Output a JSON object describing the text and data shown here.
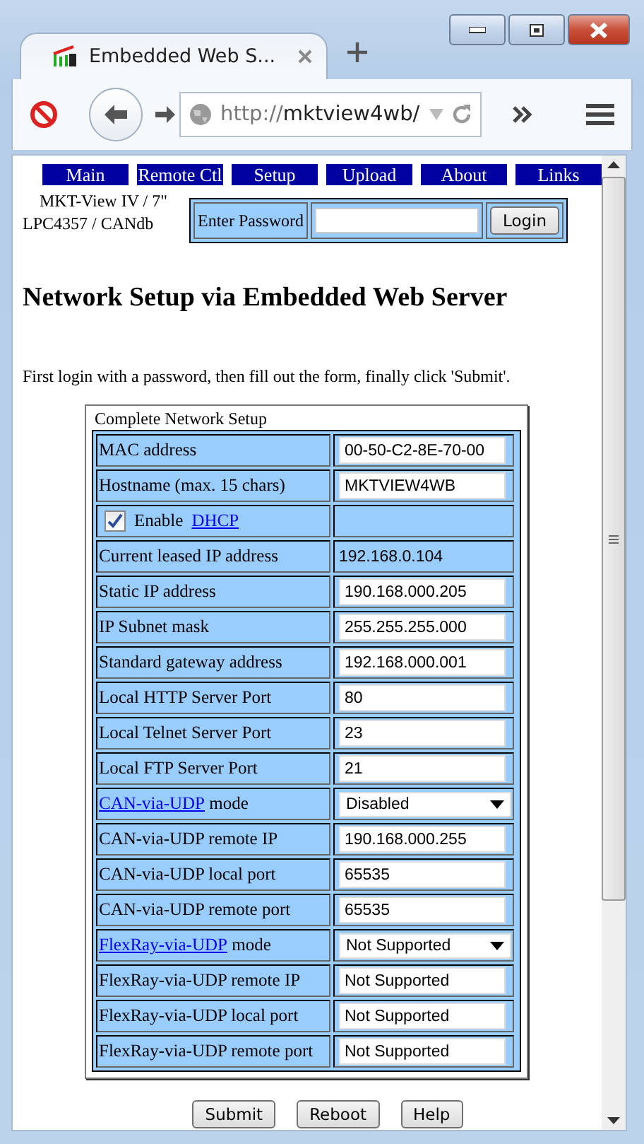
{
  "window": {
    "tab_title": "Embedded Web S...",
    "url_prefix": "http://",
    "url_host": "mktview4wb/"
  },
  "nav": [
    {
      "label": "Main"
    },
    {
      "label": "Remote Ctl"
    },
    {
      "label": "Setup"
    },
    {
      "label": "Upload"
    },
    {
      "label": "About"
    },
    {
      "label": "Links"
    }
  ],
  "device": {
    "line_1": "MKT-View IV / 7\"",
    "line_2": "LPC4357 / CANdb"
  },
  "login": {
    "label": "Enter Password",
    "button": "Login"
  },
  "heading": "Network Setup via Embedded Web Server",
  "intro": "First login with a password, then fill out the form, finally click 'Submit'.",
  "form": {
    "legend": "Complete Network Setup",
    "rows": [
      {
        "kind": "input",
        "label": "MAC address",
        "value": "00-50-C2-8E-70-00"
      },
      {
        "kind": "input",
        "label": "Hostname (max. 15 chars)",
        "value": "MKTVIEW4WB"
      },
      {
        "kind": "checkbox",
        "label": "Enable",
        "link": "DHCP",
        "checked": true
      },
      {
        "kind": "text",
        "label": "Current leased IP address",
        "value": "192.168.0.104"
      },
      {
        "kind": "input",
        "label": "Static IP address",
        "value": "190.168.000.205"
      },
      {
        "kind": "input",
        "label": "IP Subnet mask",
        "value": "255.255.255.000"
      },
      {
        "kind": "input",
        "label": "Standard gateway address",
        "value": "192.168.000.001"
      },
      {
        "kind": "input",
        "label": "Local HTTP Server Port",
        "value": "80"
      },
      {
        "kind": "input",
        "label": "Local Telnet Server Port",
        "value": "23"
      },
      {
        "kind": "input",
        "label": "Local FTP Server Port",
        "value": "21"
      },
      {
        "kind": "select",
        "link": "CAN-via-UDP",
        "label": "mode",
        "value": "Disabled"
      },
      {
        "kind": "input",
        "label": "CAN-via-UDP remote IP",
        "value": "190.168.000.255"
      },
      {
        "kind": "input",
        "label": "CAN-via-UDP local port",
        "value": "65535"
      },
      {
        "kind": "input",
        "label": "CAN-via-UDP remote port",
        "value": "65535"
      },
      {
        "kind": "select",
        "link": "FlexRay-via-UDP",
        "label": "mode",
        "value": "Not Supported"
      },
      {
        "kind": "input",
        "label": "FlexRay-via-UDP remote IP",
        "value": "Not Supported"
      },
      {
        "kind": "input",
        "label": "FlexRay-via-UDP local port",
        "value": "Not Supported"
      },
      {
        "kind": "input",
        "label": "FlexRay-via-UDP remote port",
        "value": "Not Supported"
      }
    ]
  },
  "buttons": [
    {
      "label": "Submit"
    },
    {
      "label": "Reboot"
    },
    {
      "label": "Help"
    }
  ]
}
